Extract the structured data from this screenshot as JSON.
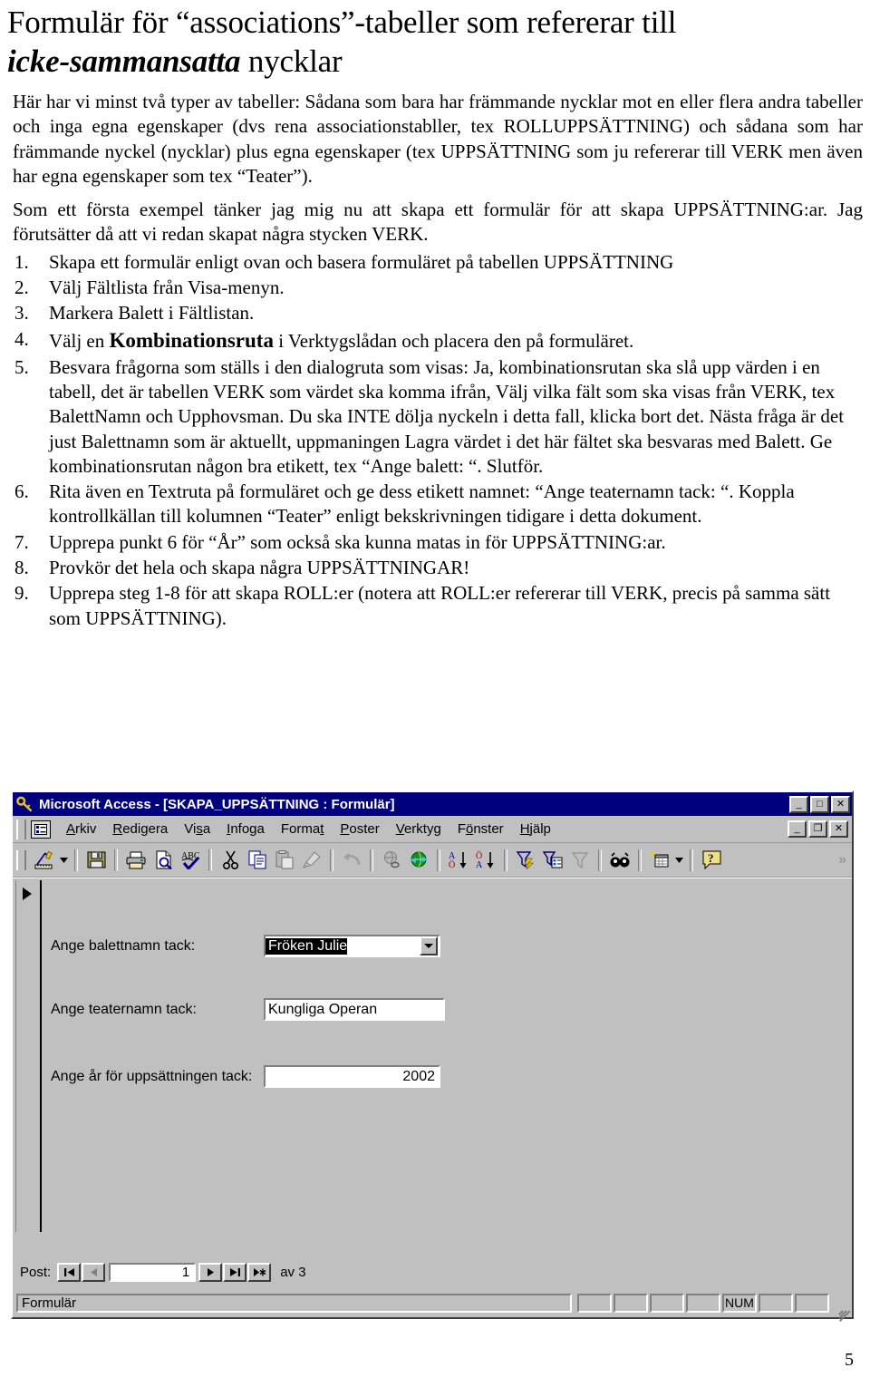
{
  "document": {
    "title_line1": "Formulär för “associations”-tabeller som refererar till",
    "title_line2_italic": "icke-sammansatta",
    "title_line2_rest": " nycklar",
    "paragraph1": "Här har vi minst två typer av tabeller: Sådana som bara har främmande nycklar mot en eller flera andra tabeller och inga egna egenskaper (dvs rena associationstabller, tex ROLLUPPSÄTTNING) och sådana som har främmande nyckel (nycklar) plus egna egenskaper (tex UPPSÄTTNING som ju refererar till VERK men även har egna egenskaper som tex “Teater”).",
    "paragraph2": "Som ett första exempel tänker jag mig nu att skapa ett formulär för att skapa UPPSÄTTNING:ar. Jag förutsätter då att vi redan skapat några stycken VERK.",
    "steps": [
      {
        "num": "1.",
        "text": "Skapa ett formulär enligt ovan och basera formuläret på tabellen UPPSÄTTNING"
      },
      {
        "num": "2.",
        "text": "Välj Fältlista från Visa-menyn."
      },
      {
        "num": "3.",
        "text": "Markera Balett i Fältlistan."
      },
      {
        "num": "4.",
        "pre": "Välj en ",
        "strong": "Kombinationsruta",
        "post": " i Verktygslådan och placera den på formuläret."
      },
      {
        "num": "5.",
        "text": "Besvara frågorna som ställs i den dialogruta som visas: Ja, kombinationsrutan ska slå upp värden i en tabell, det är tabellen VERK som värdet ska komma ifrån, Välj vilka fält som ska visas från VERK, tex BalettNamn och Upphovsman. Du ska INTE dölja nyckeln i detta fall, klicka bort det. Nästa fråga är det just Balettnamn som är aktuellt, uppmaningen Lagra värdet i det här fältet ska besvaras med Balett. Ge kombinationsrutan någon bra etikett, tex “Ange balett: “. Slutför."
      },
      {
        "num": "6.",
        "text": "Rita även en Textruta på formuläret och ge dess etikett namnet: “Ange teaternamn tack: “. Koppla kontrollkällan till kolumnen “Teater” enligt bekskrivningen tidigare i detta dokument."
      },
      {
        "num": "7.",
        "text": "Upprepa punkt 6 för “År” som också ska kunna matas in för UPPSÄTTNING:ar."
      },
      {
        "num": "8.",
        "text": "Provkör det hela och skapa några UPPSÄTTNINGAR!"
      },
      {
        "num": "9.",
        "text": "Upprepa steg 1-8 för att skapa ROLL:er (notera att ROLL:er refererar till VERK, precis på samma sätt som UPPSÄTTNING)."
      }
    ],
    "page_number": "5"
  },
  "access_window": {
    "title": "Microsoft Access - [SKAPA_UPPSÄTTNING : Formulär]",
    "app_icon": "key-icon",
    "titlebar_color": "#00007e",
    "window_buttons": [
      {
        "name": "minimize",
        "glyph": "_"
      },
      {
        "name": "maximize",
        "glyph": "□"
      },
      {
        "name": "close",
        "glyph": "✕"
      }
    ],
    "mdi_buttons": [
      {
        "name": "minimize",
        "glyph": "_"
      },
      {
        "name": "restore",
        "glyph": "❐"
      },
      {
        "name": "close",
        "glyph": "✕"
      }
    ],
    "menu": [
      {
        "label": "Arkiv",
        "accel": "A"
      },
      {
        "label": "Redigera",
        "accel": "R"
      },
      {
        "label": "Visa",
        "accel": "s"
      },
      {
        "label": "Infoga",
        "accel": "I"
      },
      {
        "label": "Format",
        "accel": "t"
      },
      {
        "label": "Poster",
        "accel": "P"
      },
      {
        "label": "Verktyg",
        "accel": "V"
      },
      {
        "label": "Fönster",
        "accel": "ö"
      },
      {
        "label": "Hjälp",
        "accel": "H"
      }
    ],
    "toolbar_buttons": [
      "design-view-icon",
      "design-view-dropdown-icon",
      "save-icon",
      "print-icon",
      "print-preview-icon",
      "spelling-icon",
      "cut-icon",
      "copy-icon",
      "paste-icon",
      "format-painter-icon",
      "undo-icon",
      "insert-hyperlink-icon",
      "web-toolbar-icon",
      "sort-ascending-icon",
      "sort-descending-icon",
      "filter-by-selection-icon",
      "filter-by-form-icon",
      "apply-filter-icon",
      "find-icon",
      "new-object-icon",
      "new-object-dropdown-icon",
      "help-icon",
      "more-buttons-icon"
    ],
    "form": {
      "fields": [
        {
          "label": "Ange balettnamn tack:",
          "control": "combobox",
          "value": "Fröken Julie",
          "selected": true
        },
        {
          "label": "Ange teaternamn tack:",
          "control": "textbox",
          "value": "Kungliga Operan",
          "align": "left"
        },
        {
          "label": "Ange år för uppsättningen tack:",
          "control": "textbox",
          "value": "2002",
          "align": "right"
        }
      ]
    },
    "navigator": {
      "label": "Post:",
      "first_glyph": "|◀",
      "prev_glyph": "◀",
      "record": "1",
      "next_glyph": "▶",
      "last_glyph": "▶|",
      "new_glyph": "▶✱",
      "total_label": "av  3"
    },
    "statusbar": {
      "message": "Formulär",
      "indicators": [
        "",
        "",
        "",
        "",
        "NUM",
        "",
        ""
      ]
    }
  }
}
